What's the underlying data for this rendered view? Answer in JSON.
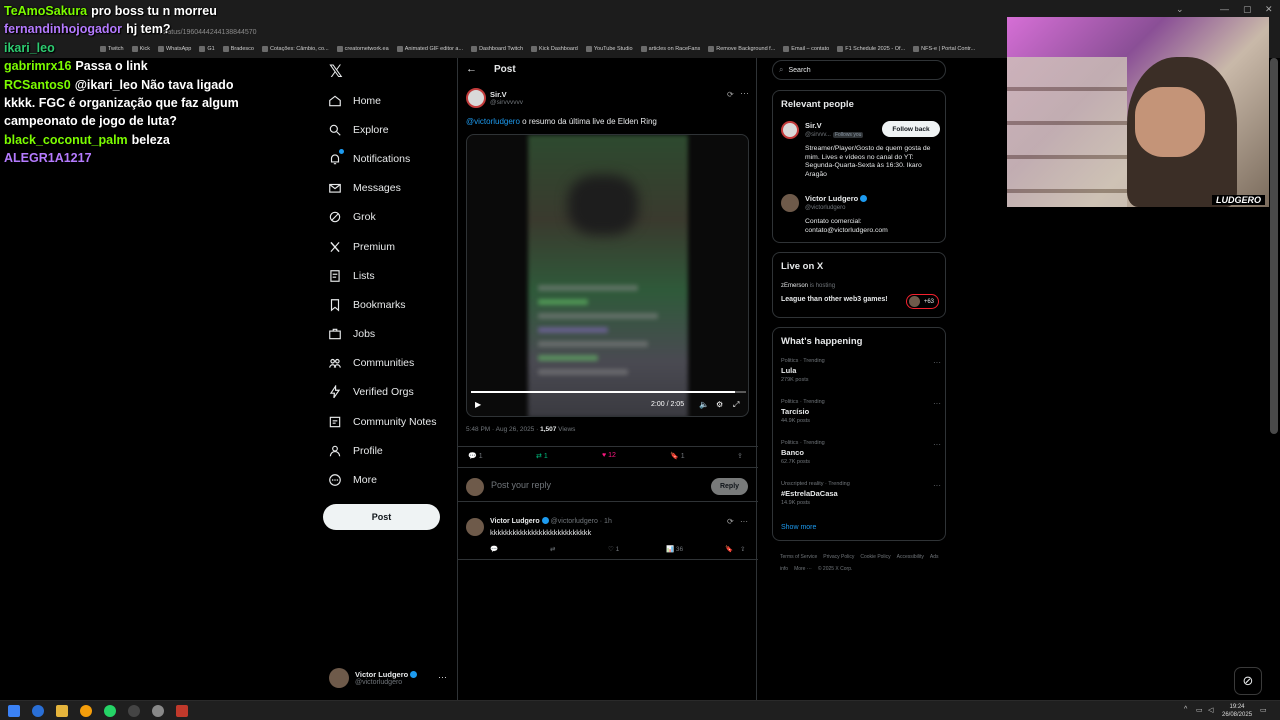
{
  "browser": {
    "url": "/status/1960444244138844570",
    "bookmarks": [
      "Twitch",
      "Kick",
      "WhatsApp",
      "G1",
      "Bradesco",
      "Cotações: Câmbio, co...",
      "creatornetwork.ea",
      "Animated GIF editor a...",
      "Dashboard Twitch",
      "Kick Dashboard",
      "YouTube Studio",
      "articles on RaceFans",
      "Remove Background f...",
      "Email – contato",
      "F1 Schedule 2025 - Of...",
      "NFS-e | Portal Contr..."
    ]
  },
  "chat": [
    {
      "user": "TeAmoSakura",
      "color": "#7CFC00",
      "text": "pro boss tu n morreu"
    },
    {
      "user": "fernandinhojogador",
      "color": "#b57bff",
      "text": "hj tem?"
    },
    {
      "user": "ikari_leo",
      "color": "#2ecc71",
      "text": ""
    },
    {
      "user": "gabrimrx16",
      "color": "#7CFC00",
      "text": "Passa o link"
    },
    {
      "user": "RCSantos0",
      "color": "#7CFC00",
      "text": "@ikari_leo Não tava ligado kkkk. FGC é organização que faz algum campeonato de jogo de luta?"
    },
    {
      "user": "black_coconut_palm",
      "color": "#7CFC00",
      "text": "beleza"
    },
    {
      "user": "ALEGR1A1217",
      "color": "#b57bff",
      "text": ""
    }
  ],
  "nav": {
    "items": [
      {
        "label": "Home",
        "icon": "home-icon"
      },
      {
        "label": "Explore",
        "icon": "search-icon"
      },
      {
        "label": "Notifications",
        "icon": "bell-icon"
      },
      {
        "label": "Messages",
        "icon": "mail-icon"
      },
      {
        "label": "Grok",
        "icon": "grok-icon"
      },
      {
        "label": "Premium",
        "icon": "x-icon"
      },
      {
        "label": "Lists",
        "icon": "list-icon"
      },
      {
        "label": "Bookmarks",
        "icon": "bookmark-icon"
      },
      {
        "label": "Jobs",
        "icon": "briefcase-icon"
      },
      {
        "label": "Communities",
        "icon": "people-icon"
      },
      {
        "label": "Verified Orgs",
        "icon": "lightning-icon"
      },
      {
        "label": "Community Notes",
        "icon": "notes-icon"
      },
      {
        "label": "Profile",
        "icon": "person-icon"
      },
      {
        "label": "More",
        "icon": "more-circle-icon"
      }
    ],
    "post_label": "Post"
  },
  "account": {
    "name": "Victor Ludgero",
    "handle": "@victorludgero"
  },
  "post": {
    "header_title": "Post",
    "author_name": "Sir.V",
    "author_handle": "@sirvvvvvv",
    "mention": "@victorludgero",
    "text": " o resumo da última live de Elden Ring",
    "video_time": "2:00 / 2:05",
    "video_progress": 0.96,
    "timestamp": "5:48 PM · Aug 26, 2025 · ",
    "views_count": "1,507",
    "views_label": " Views",
    "replies": "1",
    "reposts": "1",
    "likes": "12",
    "bookmarks": "1"
  },
  "reply_box": {
    "placeholder": "Post your reply",
    "button": "Reply"
  },
  "comment": {
    "name": "Victor Ludgero",
    "handle": "@victorludgero · 1h",
    "text": "kkkkkkkkkkkkkkkkkkkkkkkkkkk",
    "likes": "1",
    "views": "36"
  },
  "right": {
    "search_placeholder": "Search",
    "relevant_title": "Relevant people",
    "people": [
      {
        "name": "Sir.V",
        "handle": "@sirvvv...",
        "follows_you": "Follows you",
        "bio": "Streamer/Player/Gosto de quem gosta de mim. Lives e vídeos no canal do YT: Segunda-Quarta-Sexta às 16:30. Ikaro Aragão",
        "follow_label": "Follow back"
      },
      {
        "name": "Victor Ludgero",
        "handle": "@victorludgero",
        "bio": "Contato comercial: contato@victorludgero.com"
      }
    ],
    "live_title": "Live on X",
    "live": {
      "host": "zEmerson",
      "host_suffix": "is hosting",
      "title": "League than other web3 games!",
      "count": "+63"
    },
    "happening_title": "What's happening",
    "trends": [
      {
        "category": "Politics · Trending",
        "name": "Lula",
        "posts": "279K posts"
      },
      {
        "category": "Politics · Trending",
        "name": "Tarcísio",
        "posts": "44.9K posts"
      },
      {
        "category": "Politics · Trending",
        "name": "Banco",
        "posts": "62.7K posts"
      },
      {
        "category": "Unscripted reality · Trending",
        "name": "#EstrelaDaCasa",
        "posts": "14.9K posts"
      }
    ],
    "show_more": "Show more",
    "footer": [
      "Terms of Service",
      "Privacy Policy",
      "Cookie Policy",
      "Accessibility",
      "Ads info",
      "More ···",
      "© 2025 X Corp."
    ]
  },
  "webcam": {
    "logo": "LUDGERO"
  },
  "taskbar": {
    "time": "19:24",
    "date": "26/08/2025"
  }
}
